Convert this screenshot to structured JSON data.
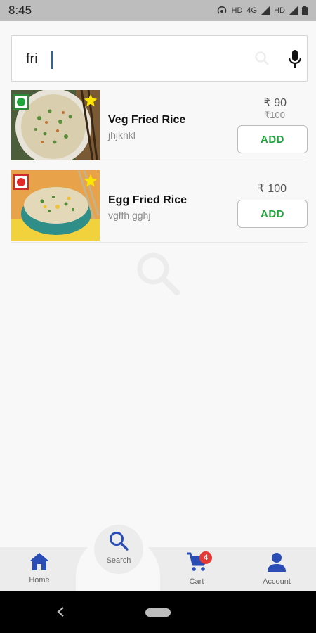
{
  "status_bar": {
    "time": "8:45",
    "signal_text_1": "HD",
    "signal_text_2": "4G",
    "signal_text_3": "HD"
  },
  "search": {
    "value": "fri",
    "search_icon": "search-icon",
    "mic_icon": "mic-icon"
  },
  "items": [
    {
      "name": "Veg Fried Rice",
      "description": "jhjkhkl",
      "price": "₹ 90",
      "old_price": "₹100",
      "add_label": "ADD",
      "diet": "veg",
      "favorite": true
    },
    {
      "name": "Egg Fried Rice",
      "description": "vgffh gghj",
      "price": "₹ 100",
      "old_price": "",
      "add_label": "ADD",
      "diet": "non-veg",
      "favorite": true
    }
  ],
  "bottom_nav": {
    "home": "Home",
    "search": "Search",
    "cart": "Cart",
    "cart_count": "4",
    "account": "Account"
  },
  "colors": {
    "accent_blue": "#2a4db5",
    "veg_green": "#1fa33a",
    "nonveg_red": "#e02a2a",
    "badge_red": "#e53935"
  }
}
